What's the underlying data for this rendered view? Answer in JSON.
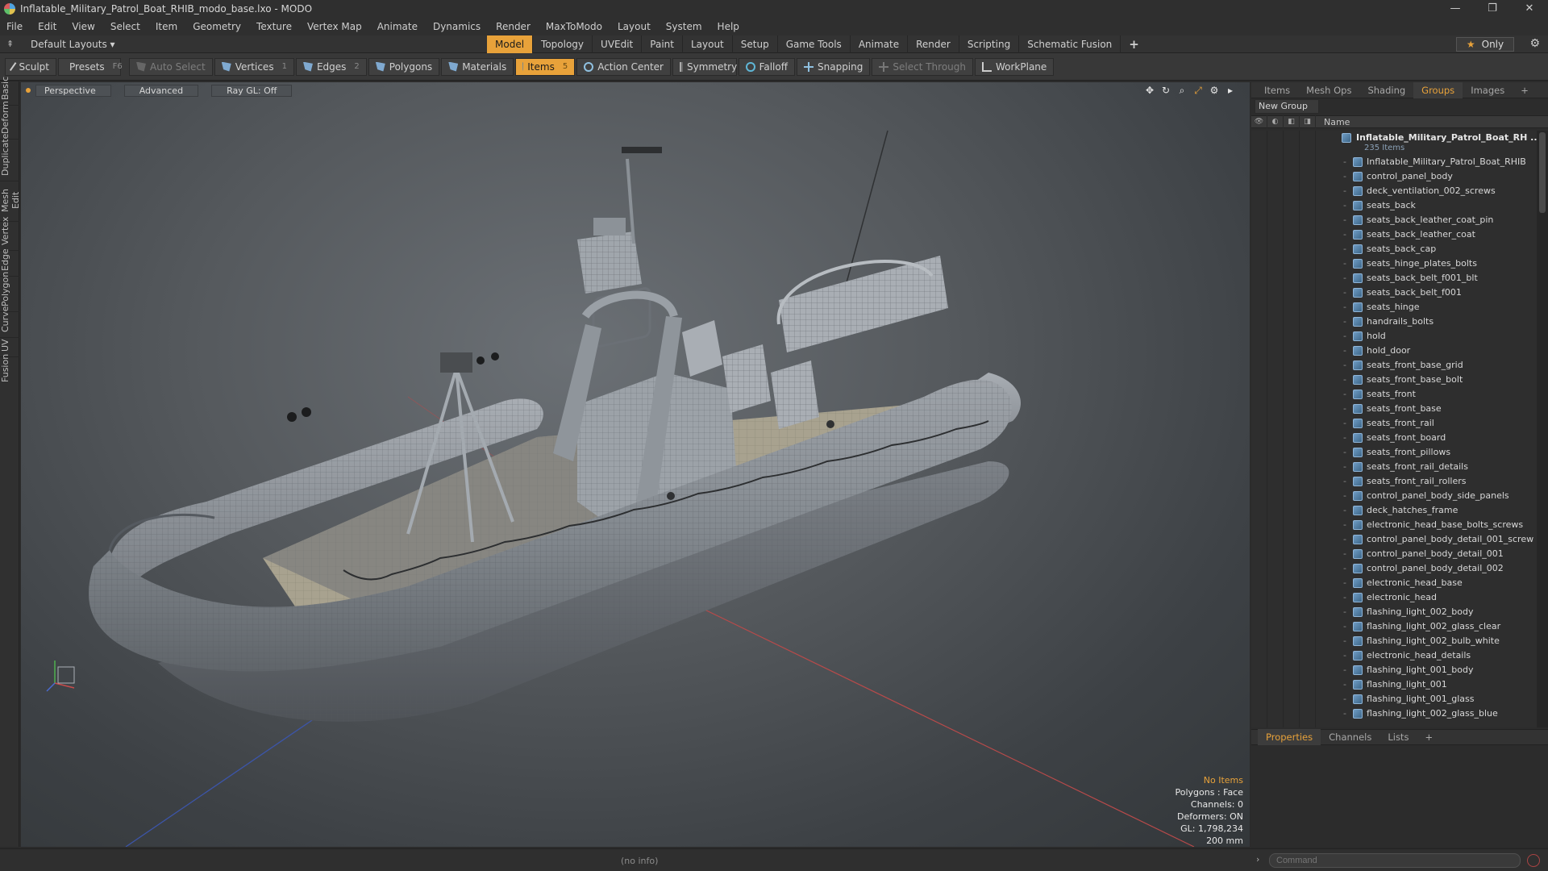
{
  "window": {
    "title": "Inflatable_Military_Patrol_Boat_RHIB_modo_base.lxo - MODO",
    "controls": [
      "—",
      "❐",
      "✕"
    ]
  },
  "menu": [
    "File",
    "Edit",
    "View",
    "Select",
    "Item",
    "Geometry",
    "Texture",
    "Vertex Map",
    "Animate",
    "Dynamics",
    "Render",
    "MaxToModo",
    "Layout",
    "System",
    "Help"
  ],
  "layout_bar": {
    "layout_selector": "Default Layouts ▾",
    "tabs": [
      {
        "label": "Model",
        "active": true
      },
      {
        "label": "Topology"
      },
      {
        "label": "UVEdit"
      },
      {
        "label": "Paint"
      },
      {
        "label": "Layout"
      },
      {
        "label": "Setup"
      },
      {
        "label": "Game Tools"
      },
      {
        "label": "Animate"
      },
      {
        "label": "Render"
      },
      {
        "label": "Scripting"
      },
      {
        "label": "Schematic Fusion"
      }
    ],
    "add": "+",
    "only_label": "Only"
  },
  "toolbar": {
    "sculpt": "Sculpt",
    "presets": "Presets",
    "presets_key": "F6",
    "auto_select": "Auto Select",
    "vertices": "Vertices",
    "vertices_key": "1",
    "edges": "Edges",
    "edges_key": "2",
    "polygons": "Polygons",
    "materials": "Materials",
    "items": "Items",
    "items_key": "5",
    "action_center": "Action Center",
    "symmetry": "Symmetry",
    "falloff": "Falloff",
    "snapping": "Snapping",
    "select_through": "Select Through",
    "workplane": "WorkPlane"
  },
  "left_tabs": [
    "Basic",
    "Deform",
    "Duplicate",
    "Mesh Edit",
    "Vertex",
    "Edge",
    "Polygon",
    "Curve",
    "UV",
    "Fusion"
  ],
  "viewport": {
    "view": "Perspective",
    "shading": "Advanced",
    "raygl": "Ray GL: Off",
    "info": {
      "items": "No Items",
      "polygons": "Polygons : Face",
      "channels": "Channels: 0",
      "deformers": "Deformers: ON",
      "gl": "GL: 1,798,234",
      "scale": "200 mm"
    }
  },
  "right_panel": {
    "tabs": [
      {
        "label": "Items"
      },
      {
        "label": "Mesh Ops"
      },
      {
        "label": "Shading"
      },
      {
        "label": "Groups",
        "active": true
      },
      {
        "label": "Images"
      },
      {
        "label": "+"
      }
    ],
    "new_group": "New Group",
    "name_header": "Name",
    "root": {
      "label": "Inflatable_Military_Patrol_Boat_RH ...",
      "count": "235 Items"
    },
    "items": [
      "Inflatable_Military_Patrol_Boat_RHIB",
      "control_panel_body",
      "deck_ventilation_002_screws",
      "seats_back",
      "seats_back_leather_coat_pin",
      "seats_back_leather_coat",
      "seats_back_cap",
      "seats_hinge_plates_bolts",
      "seats_back_belt_f001_blt",
      "seats_back_belt_f001",
      "seats_hinge",
      "handrails_bolts",
      "hold",
      "hold_door",
      "seats_front_base_grid",
      "seats_front_base_bolt",
      "seats_front",
      "seats_front_base",
      "seats_front_rail",
      "seats_front_board",
      "seats_front_pillows",
      "seats_front_rail_details",
      "seats_front_rail_rollers",
      "control_panel_body_side_panels",
      "deck_hatches_frame",
      "electronic_head_base_bolts_screws",
      "control_panel_body_detail_001_screw",
      "control_panel_body_detail_001",
      "control_panel_body_detail_002",
      "electronic_head_base",
      "electronic_head",
      "flashing_light_002_body",
      "flashing_light_002_glass_clear",
      "flashing_light_002_bulb_white",
      "electronic_head_details",
      "flashing_light_001_body",
      "flashing_light_001",
      "flashing_light_001_glass",
      "flashing_light_002_glass_blue"
    ],
    "bottom_tabs": [
      {
        "label": "Properties",
        "active": true
      },
      {
        "label": "Channels"
      },
      {
        "label": "Lists"
      },
      {
        "label": "+"
      }
    ]
  },
  "status": {
    "info": "(no info)",
    "command_placeholder": "Command"
  },
  "colors": {
    "accent": "#e8a23a",
    "mesh_icon": "#6f9cc4"
  }
}
